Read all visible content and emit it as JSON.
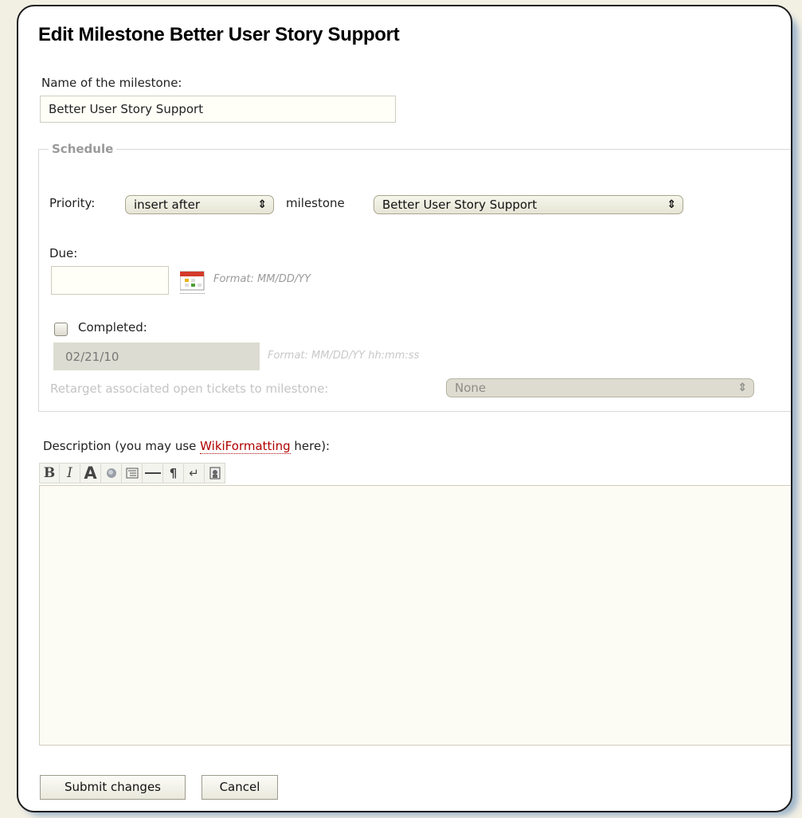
{
  "page": {
    "title": "Edit Milestone Better User Story Support",
    "name_label": "Name of the milestone:",
    "name_value": "Better User Story Support"
  },
  "schedule": {
    "legend": "Schedule",
    "priority_label": "Priority:",
    "priority_value": "insert after",
    "milestone_label": "milestone",
    "milestone_value": "Better User Story Support",
    "due_label": "Due:",
    "due_value": "",
    "due_format": "Format: MM/DD/YY",
    "completed_label": "Completed:",
    "completed_checked": false,
    "completed_value": "02/21/10",
    "completed_format": "Format: MM/DD/YY hh:mm:ss",
    "retarget_label": "Retarget associated open tickets to milestone:",
    "retarget_value": "None"
  },
  "description": {
    "label_prefix": "Description (you may use ",
    "link": "WikiFormatting",
    "label_suffix": " here):",
    "toolbar": [
      "bold-icon",
      "italic-icon",
      "heading-icon",
      "link-icon",
      "code-block-icon",
      "horizontal-rule-icon",
      "paragraph-icon",
      "line-break-icon",
      "image-icon"
    ]
  },
  "buttons": {
    "submit": "Submit changes",
    "cancel": "Cancel"
  },
  "colors": {
    "link": "#b00000",
    "card_border": "#1c1c1c",
    "shadow": "#8aa6c4"
  }
}
